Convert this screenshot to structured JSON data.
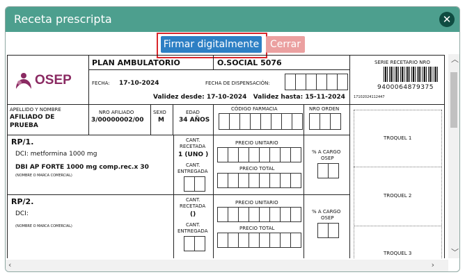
{
  "dialog": {
    "title": "Receta prescripta",
    "sign_button": "Firmar digitalmente",
    "close_button": "Cerrar"
  },
  "icons": {
    "close": "close-icon",
    "up": "chevron-up-icon",
    "down": "chevron-down-icon",
    "left": "chevron-left-icon",
    "right": "chevron-right-icon"
  },
  "colors": {
    "titlebar": "#4d9f8e",
    "primary_button": "#2d7fc4",
    "close_button": "#eba0a0",
    "highlight": "#d9262b"
  },
  "prescription": {
    "logo": "OSEP",
    "plan": "PLAN AMBULATORIO",
    "obra_social": "O.SOCIAL 5076",
    "fecha_label": "FECHA:",
    "fecha": "17-10-2024",
    "fecha_dispensacion_label": "FECHA DE DISPENSACIÓN:",
    "validez": "Validez desde: 17-10-2024   Validez hasta: 15-11-2024",
    "serie_label": "SERIE RECETARIO NRO",
    "barcode_number": "9400064879375",
    "barcode_small": "17102024112447",
    "headers": {
      "apellido": "APELLIDO Y NOMBRE",
      "nro_afiliado": "NRO AFILIADO",
      "sexo": "SEXO",
      "edad": "EDAD",
      "codigo_farmacia": "CÓDIGO FARMACIA",
      "nro_orden": "NRO ORDEN"
    },
    "patient": {
      "name_line1": "AFILIADO DE",
      "name_line2": "PRUEBA",
      "nro_afiliado": "3/00000002/00",
      "sexo": "M",
      "edad": "34 AÑOS"
    },
    "labels": {
      "cant_recetada_1": "CANT.",
      "cant_recetada_2": "RECETADA",
      "cant_entregada_1": "CANT.",
      "cant_entregada_2": "ENTREGADA",
      "precio_unitario": "PRECIO UNITARIO",
      "precio_total": "PRECIO TOTAL",
      "a_cargo_1": "% A CARGO",
      "a_cargo_2": "OSEP",
      "marca": "(NOMBRE O MARCA COMERCIAL)"
    },
    "rp1": {
      "label": "RP/1.",
      "dci": "DCI: metformina 1000 mg",
      "brand": "DBI AP FORTE 1000 mg comp.rec.x 30",
      "cantidad": "1 (UNO )"
    },
    "rp2": {
      "label": "RP/2.",
      "dci": "DCI:",
      "cantidad": "()"
    },
    "troqueles": [
      "TROQUEL 1",
      "TROQUEL 2",
      "TROQUEL 3"
    ]
  }
}
